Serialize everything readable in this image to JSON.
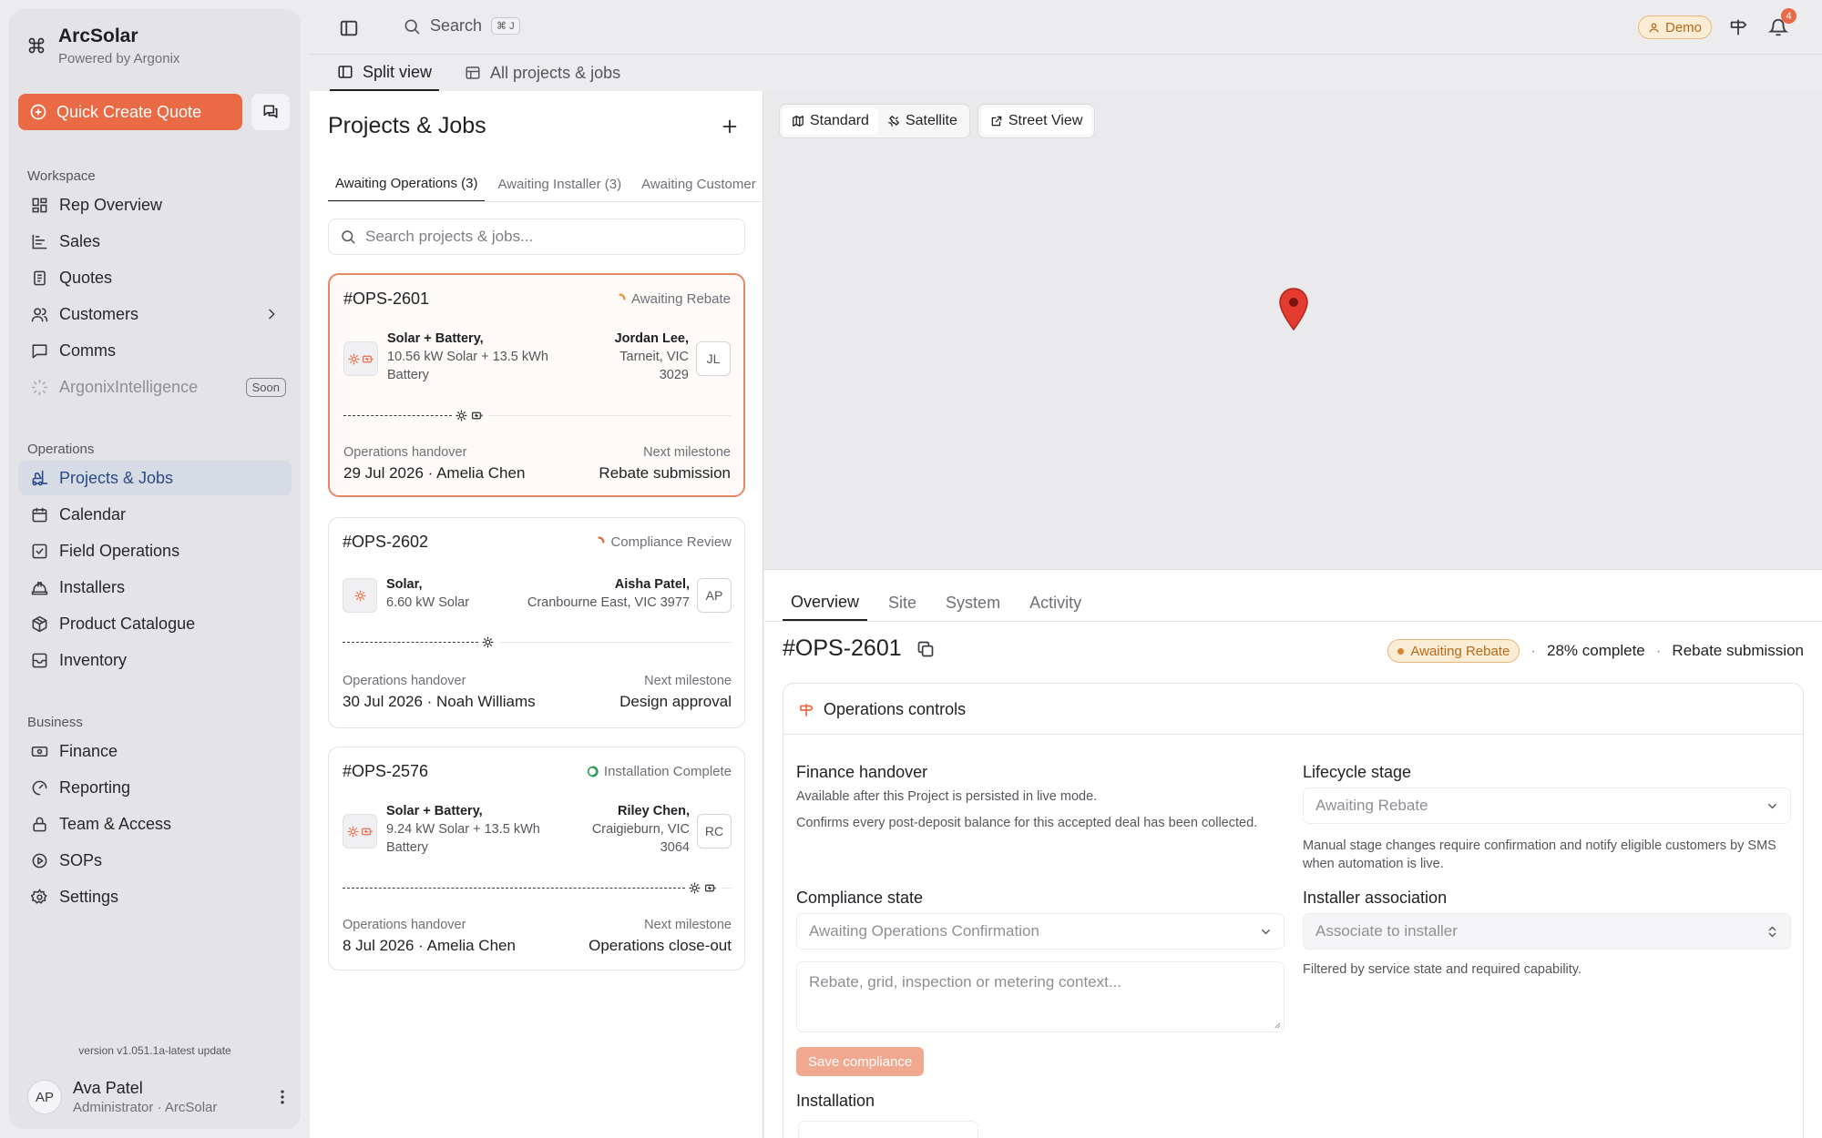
{
  "brand": {
    "name": "ArcSolar",
    "subtitle": "Powered by Argonix"
  },
  "sidebar": {
    "quick_create_label": "Quick Create Quote",
    "sections": {
      "workspace": "Workspace",
      "operations": "Operations",
      "business": "Business"
    },
    "workspace_items": [
      "Rep Overview",
      "Sales",
      "Quotes",
      "Customers",
      "Comms",
      "ArgonixIntelligence"
    ],
    "soon_badge": "Soon",
    "operations_items": [
      "Projects & Jobs",
      "Calendar",
      "Field Operations",
      "Installers",
      "Product Catalogue",
      "Inventory"
    ],
    "business_items": [
      "Finance",
      "Reporting",
      "Team & Access",
      "SOPs",
      "Settings"
    ],
    "version": "version v1.051.1a-latest update",
    "user": {
      "initials": "AP",
      "name": "Ava Patel",
      "role": "Administrator · ArcSolar"
    }
  },
  "topbar": {
    "search_label": "Search",
    "search_shortcut": "⌘ J",
    "demo_label": "Demo",
    "notification_count": "4"
  },
  "view_tabs": [
    "Split view",
    "All projects & jobs"
  ],
  "list": {
    "title": "Projects & Jobs",
    "filter_tabs": [
      "Awaiting Operations (3)",
      "Awaiting Installer (3)",
      "Awaiting Customer"
    ],
    "search_placeholder": "Search projects & jobs...",
    "handover_label": "Operations handover",
    "milestone_label": "Next milestone",
    "jobs": [
      {
        "id": "#OPS-2601",
        "status": "Awaiting Rebate",
        "status_color": "#e8932e",
        "product_title": "Solar + Battery,",
        "product_detail_1": "10.56 kW Solar + 13.5 kWh",
        "product_detail_2": "Battery",
        "customer": "Jordan Lee,",
        "location_1": "Tarneit, VIC",
        "location_2": "3029",
        "initials": "JL",
        "handover": "29 Jul 2026 · Amelia Chen",
        "milestone": "Rebate submission",
        "progress": 0.28
      },
      {
        "id": "#OPS-2602",
        "status": "Compliance Review",
        "status_color": "#e0643c",
        "product_title": "Solar,",
        "product_detail_1": "6.60 kW Solar",
        "customer": "Aisha Patel,",
        "location_1": "Cranbourne East, VIC 3977",
        "initials": "AP",
        "handover": "30 Jul 2026 · Noah Williams",
        "milestone": "Design approval",
        "progress": 0.35
      },
      {
        "id": "#OPS-2576",
        "status": "Installation Complete",
        "status_color": "#2f9e5a",
        "product_title": "Solar + Battery,",
        "product_detail_1": "9.24 kW Solar + 13.5 kWh",
        "product_detail_2": "Battery",
        "customer": "Riley Chen,",
        "location_1": "Craigieburn, VIC",
        "location_2": "3064",
        "initials": "RC",
        "handover": "8 Jul 2026 · Amelia Chen",
        "milestone": "Operations close-out",
        "progress": 0.88
      }
    ]
  },
  "map": {
    "standard_label": "Standard",
    "satellite_label": "Satellite",
    "street_view_label": "Street View"
  },
  "detail": {
    "tabs": [
      "Overview",
      "Site",
      "System",
      "Activity"
    ],
    "job_id": "#OPS-2601",
    "status": "Awaiting Rebate",
    "progress_text": "28% complete",
    "milestone": "Rebate submission",
    "controls_title": "Operations controls",
    "finance": {
      "label": "Finance handover",
      "help_1": "Available after this Project is persisted in live mode.",
      "help_2": "Confirms every post-deposit balance for this accepted deal has been collected."
    },
    "lifecycle": {
      "label": "Lifecycle stage",
      "value": "Awaiting Rebate",
      "help": "Manual stage changes require confirmation and notify eligible customers by SMS when automation is live."
    },
    "compliance": {
      "label": "Compliance state",
      "value": "Awaiting Operations Confirmation",
      "notes_placeholder": "Rebate, grid, inspection or metering context...",
      "save_label": "Save compliance"
    },
    "installer": {
      "label": "Installer association",
      "placeholder": "Associate to installer",
      "help": "Filtered by service state and required capability."
    },
    "installation_label": "Installation"
  }
}
